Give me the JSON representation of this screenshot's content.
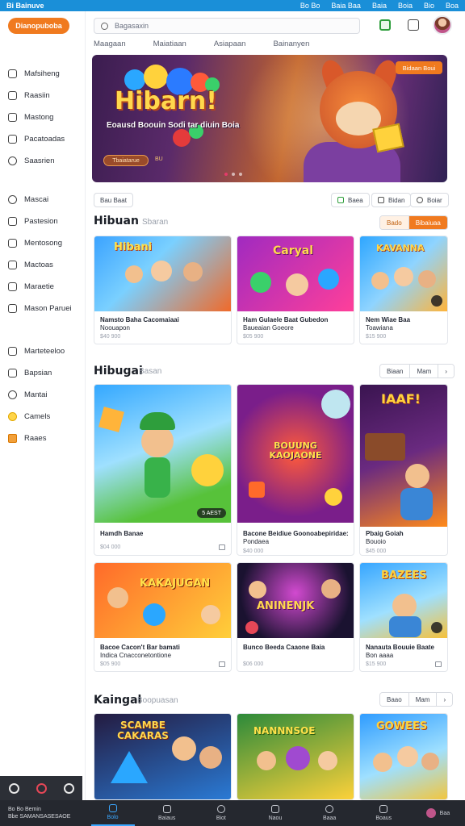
{
  "sysbar": {
    "brand": "Bi Bainuve",
    "links": [
      "Bo Bo",
      "Baia Baa",
      "Baia",
      "Boia",
      "Bio",
      "Boa"
    ]
  },
  "sidebar": {
    "cta": "Dianopuboba",
    "group1": [
      {
        "label": "Mafsiheng",
        "icon": "home-icon"
      },
      {
        "label": "Raasiin",
        "icon": "grid-icon"
      },
      {
        "label": "Mastong",
        "icon": "bookmark-icon"
      },
      {
        "label": "Pacatoadas",
        "icon": "folder-icon"
      },
      {
        "label": "Saasrien",
        "icon": "globe-icon"
      }
    ],
    "group2": [
      {
        "label": "Mascai",
        "icon": "link-icon"
      },
      {
        "label": "Pastesion",
        "icon": "users-icon"
      },
      {
        "label": "Mentosong",
        "icon": "tv-icon"
      },
      {
        "label": "Mactoas",
        "icon": "document-icon"
      },
      {
        "label": "Maraetie",
        "icon": "play-icon"
      },
      {
        "label": "Mason Paruei",
        "icon": "shield-icon"
      }
    ],
    "group3": [
      {
        "label": "Marteteeloo",
        "icon": "chart-icon"
      },
      {
        "label": "Bapsian",
        "icon": "rocket-icon"
      },
      {
        "label": "Mantai",
        "icon": "settings-icon"
      },
      {
        "label": "Camels",
        "icon": "coin-icon"
      },
      {
        "label": "Raaes",
        "icon": "trophy-icon"
      }
    ],
    "dock_icons": [
      "moon-icon",
      "heart-icon",
      "chat-icon"
    ]
  },
  "header": {
    "search_value": "Bagasaxin",
    "tabs": [
      "Maagaan",
      "Maiatiaan",
      "Asiapaan",
      "Bainanyen"
    ]
  },
  "hero": {
    "title": "Hibarn!",
    "subtitle": "Eoausd Boouin Sodi tar diuin Boia",
    "button": "Tbaiatarue",
    "tag": "BU",
    "badge": "Bidaan Boui"
  },
  "filters": {
    "left": "Bau Baat",
    "right": [
      "Baea",
      "Bidan",
      "Boiar"
    ]
  },
  "sections": [
    {
      "title": "Hibuan",
      "subtitle": "Sbaran",
      "controls": [
        "Bado",
        "Bibaiuaa"
      ]
    },
    {
      "title": "Hibugai",
      "subtitle": "Basan",
      "controls": [
        "Biaan",
        "Mam"
      ]
    },
    {
      "title": "Kaingal",
      "subtitle": "Boopuasan",
      "controls": [
        "Baao",
        "Mam"
      ]
    }
  ],
  "cards_row1": [
    {
      "title": "Namsto Baha Cacomaiaai",
      "title2": "Noouapon",
      "meta": "$40 900",
      "thumb_text": "Hibani",
      "colors": [
        "#3ba3ff",
        "#f06a2a"
      ]
    },
    {
      "title": "Ham Gulaele Baat Gubedon",
      "title2": "Baueaian Goeore",
      "meta": "$05 900",
      "thumb_text": "Caryal",
      "colors": [
        "#a02ac0",
        "#ff3f9a"
      ]
    },
    {
      "title": "Nem Wiae Baa",
      "title2": "Toawiana",
      "meta": "$15 900",
      "thumb_text": "KAVANNA",
      "colors": [
        "#2ea6ff",
        "#ffb43a"
      ]
    }
  ],
  "cards_row2": [
    {
      "title": "Hamdh Banae",
      "title2": "",
      "meta": "$04 000",
      "thumb_text": "",
      "chip": "5 AEST",
      "colors": [
        "#34a8ff",
        "#57c23a"
      ]
    },
    {
      "title": "Bacone Beidiue Goonoabepiridae:",
      "title2": "Pondaea",
      "meta": "$40 000",
      "thumb_text": "BOUUNG KAOJAONE",
      "colors": [
        "#7a1e8a",
        "#ff5a3a"
      ]
    },
    {
      "title": "Pbaig Goiah",
      "title2": "Bouoio",
      "meta": "$45 000",
      "thumb_text": "IAAF!",
      "colors": [
        "#3a1450",
        "#ff8a1a"
      ]
    }
  ],
  "cards_row3": [
    {
      "title": "Bacoe Cacon't Bar bamati",
      "title2": "Indica Cnacconetontione",
      "meta": "$05 900",
      "thumb_text": "KAKAJUGAN",
      "colors": [
        "#ff6a2a",
        "#ffcf3a"
      ]
    },
    {
      "title": "Bunco Beeda Caaone Baia",
      "title2": "",
      "meta": "$06 000",
      "thumb_text": "ANINENJK",
      "colors": [
        "#1a1230",
        "#d24ad0"
      ]
    },
    {
      "title": "Nanauta Bouuie Baate",
      "title2": "Bon aaaa",
      "meta": "$15 900",
      "thumb_text": "BAZEES",
      "colors": [
        "#37a6ff",
        "#f6c13a"
      ]
    }
  ],
  "cards_row4": [
    {
      "thumb_text": "SCAMBE CAKARAS",
      "colors": [
        "#241b40",
        "#2a7bd6"
      ]
    },
    {
      "thumb_text": "NANNNSOE",
      "colors": [
        "#2c8a3a",
        "#ffd23a"
      ]
    },
    {
      "thumb_text": "GOWEES",
      "colors": [
        "#2f9cff",
        "#f4c53a"
      ]
    }
  ],
  "bottom_nav": {
    "left_line1": "Bo Bo Bemin",
    "left_line2": "Bbe SAMANSASESAOE",
    "items": [
      "Bolo",
      "Baiaus",
      "Biot",
      "Naou",
      "Baaa",
      "Boaus"
    ],
    "active_index": 0,
    "right_text": "Baa"
  }
}
